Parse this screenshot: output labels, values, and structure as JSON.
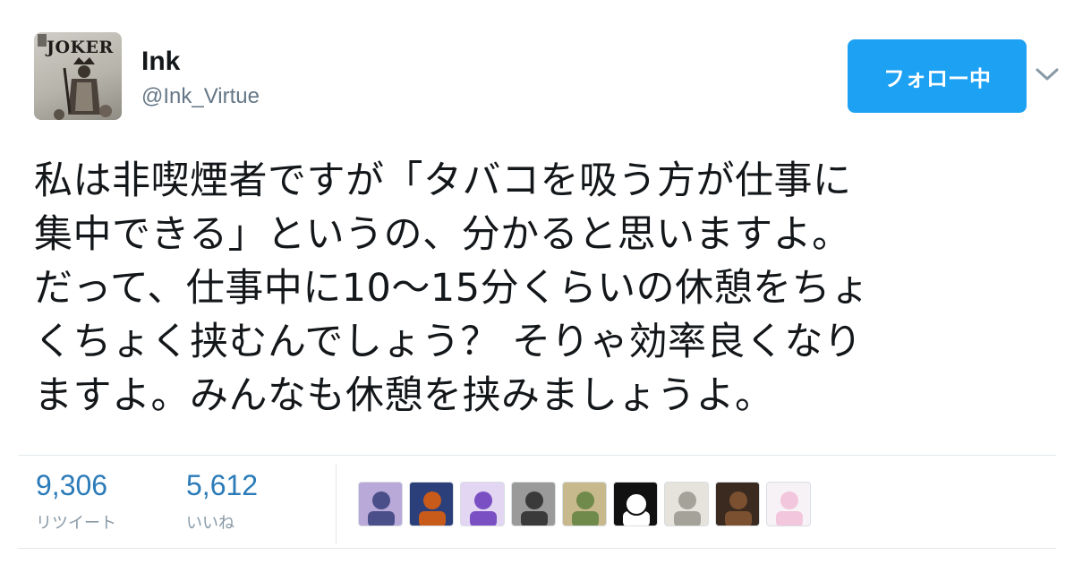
{
  "user": {
    "avatar_text": "JOKER",
    "name": "Ink",
    "handle": "@Ink_Virtue"
  },
  "follow_button": {
    "label": "フォロー中"
  },
  "menu": {
    "icon": "chevron-down-icon"
  },
  "tweet": {
    "lines": [
      "私は非喫煙者ですが「タバコを吸う方が仕事に",
      "集中できる」というの、分かると思いますよ。",
      "だって、仕事中に10～15分くらいの休憩をちょ",
      "くちょく挟むんでしょう？ そりゃ効率良くなり",
      "ますよ。みんなも休憩を挟みましょうよ。"
    ]
  },
  "stats": {
    "retweets": {
      "value": "9,306",
      "label": "リツイート"
    },
    "likes": {
      "value": "5,612",
      "label": "いいね"
    }
  },
  "liker_avatars": [
    {
      "name": "liker-avatar-1",
      "colors": [
        "#4a4f8a",
        "#b9a9d8"
      ]
    },
    {
      "name": "liker-avatar-2",
      "colors": [
        "#c85a1a",
        "#2b3f7a"
      ]
    },
    {
      "name": "liker-avatar-3",
      "colors": [
        "#7b4fc4",
        "#e2d6f2"
      ]
    },
    {
      "name": "liker-avatar-4",
      "colors": [
        "#3a3a3a",
        "#9a9a9a"
      ]
    },
    {
      "name": "liker-avatar-5",
      "colors": [
        "#6f8a4a",
        "#c7b98c"
      ]
    },
    {
      "name": "liker-avatar-6",
      "colors": [
        "#ffffff",
        "#111111"
      ]
    },
    {
      "name": "liker-avatar-7",
      "colors": [
        "#a5a29a",
        "#e6e3dc"
      ]
    },
    {
      "name": "liker-avatar-8",
      "colors": [
        "#7a5030",
        "#3b2a1f"
      ]
    },
    {
      "name": "liker-avatar-9",
      "colors": [
        "#f2c6dc",
        "#f7f2f5"
      ]
    }
  ],
  "colors": {
    "accent": "#1da1f2",
    "stat_value": "#2b7bb9",
    "secondary_text": "#657786",
    "divider": "#e1e8ed"
  }
}
